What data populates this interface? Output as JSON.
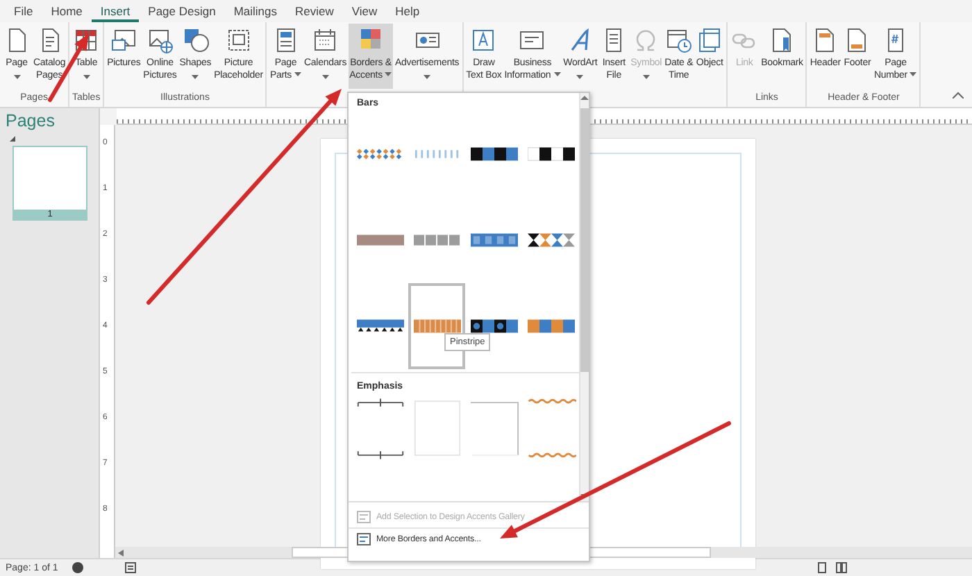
{
  "tabs": [
    {
      "label": "File",
      "selected": false
    },
    {
      "label": "Home",
      "selected": false
    },
    {
      "label": "Insert",
      "selected": true
    },
    {
      "label": "Page Design",
      "selected": false
    },
    {
      "label": "Mailings",
      "selected": false
    },
    {
      "label": "Review",
      "selected": false
    },
    {
      "label": "View",
      "selected": false
    },
    {
      "label": "Help",
      "selected": false
    }
  ],
  "ribbon": {
    "groups": [
      {
        "label": "Pages",
        "buttons": [
          {
            "label": "Page",
            "dropdown": true,
            "selected": false,
            "disabled": false
          },
          {
            "label": "Catalog\nPages",
            "dropdown": false,
            "selected": false,
            "disabled": false
          }
        ]
      },
      {
        "label": "Tables",
        "buttons": [
          {
            "label": "Table",
            "dropdown": true,
            "selected": false,
            "disabled": false
          }
        ]
      },
      {
        "label": "Illustrations",
        "buttons": [
          {
            "label": "Pictures",
            "dropdown": false,
            "selected": false,
            "disabled": false
          },
          {
            "label": "Online\nPictures",
            "dropdown": false,
            "selected": false,
            "disabled": false
          },
          {
            "label": "Shapes",
            "dropdown": true,
            "selected": false,
            "disabled": false
          },
          {
            "label": "Picture\nPlaceholder",
            "dropdown": false,
            "selected": false,
            "disabled": false
          }
        ]
      },
      {
        "buttons": [
          {
            "label": "Page\nParts",
            "dropdown": true,
            "selected": false,
            "disabled": false
          },
          {
            "label": "Calendars",
            "dropdown": true,
            "selected": false,
            "disabled": false
          },
          {
            "label": "Borders &\nAccents",
            "dropdown": true,
            "selected": true,
            "disabled": false
          },
          {
            "label": "Advertisements",
            "dropdown": true,
            "selected": false,
            "disabled": false
          }
        ]
      },
      {
        "buttons": [
          {
            "label": "Draw\nText Box",
            "dropdown": false,
            "selected": false,
            "disabled": false
          },
          {
            "label": "Business\nInformation",
            "dropdown": true,
            "selected": false,
            "disabled": false
          },
          {
            "label": "WordArt",
            "dropdown": true,
            "selected": false,
            "disabled": false
          },
          {
            "label": "Insert\nFile",
            "dropdown": false,
            "selected": false,
            "disabled": false
          },
          {
            "label": "Symbol",
            "dropdown": true,
            "selected": false,
            "disabled": true
          },
          {
            "label": "Date &\nTime",
            "dropdown": false,
            "selected": false,
            "disabled": false
          },
          {
            "label": "Object",
            "dropdown": false,
            "selected": false,
            "disabled": false
          }
        ]
      },
      {
        "label": "Links",
        "buttons": [
          {
            "label": "Link",
            "dropdown": false,
            "selected": false,
            "disabled": true
          },
          {
            "label": "Bookmark",
            "dropdown": false,
            "selected": false,
            "disabled": false
          }
        ]
      },
      {
        "label": "Header & Footer",
        "buttons": [
          {
            "label": "Header",
            "dropdown": false,
            "selected": false,
            "disabled": false
          },
          {
            "label": "Footer",
            "dropdown": false,
            "selected": false,
            "disabled": false
          },
          {
            "label": "Page\nNumber",
            "dropdown": true,
            "selected": false,
            "disabled": false
          }
        ]
      }
    ]
  },
  "pages_pane": {
    "title": "Pages",
    "pages": [
      {
        "number": "1",
        "selected": true
      }
    ]
  },
  "vertical_ruler": [
    "0",
    "1",
    "2",
    "3",
    "4",
    "5",
    "6",
    "7",
    "8"
  ],
  "gallery": {
    "sections": [
      {
        "title": "Bars",
        "items": [
          {
            "kind": "diamonds",
            "selected": false
          },
          {
            "kind": "ticks",
            "selected": false
          },
          {
            "kind": "checker",
            "selected": false
          },
          {
            "kind": "gapblocks",
            "selected": false
          },
          {
            "kind": "solid",
            "selected": false
          },
          {
            "kind": "segments",
            "selected": false
          },
          {
            "kind": "tiles",
            "selected": false
          },
          {
            "kind": "hourglass",
            "selected": false
          },
          {
            "kind": "band",
            "selected": false
          },
          {
            "kind": "stripes",
            "selected": true,
            "tooltip": "Pinstripe"
          },
          {
            "kind": "circles",
            "selected": false
          },
          {
            "kind": "squares",
            "selected": false
          }
        ]
      },
      {
        "title": "Emphasis",
        "items": [
          {
            "kind": "corner-frame",
            "selected": false
          },
          {
            "kind": "plain-frame",
            "selected": false
          },
          {
            "kind": "line-frame",
            "selected": false
          },
          {
            "kind": "lace-frame",
            "selected": false
          }
        ]
      }
    ],
    "commands": [
      {
        "label": "Add Selection to Design Accents Gallery",
        "disabled": true
      },
      {
        "label": "More Borders and Accents...",
        "disabled": false
      }
    ]
  },
  "status_bar": {
    "page": "Page: 1 of 1"
  }
}
